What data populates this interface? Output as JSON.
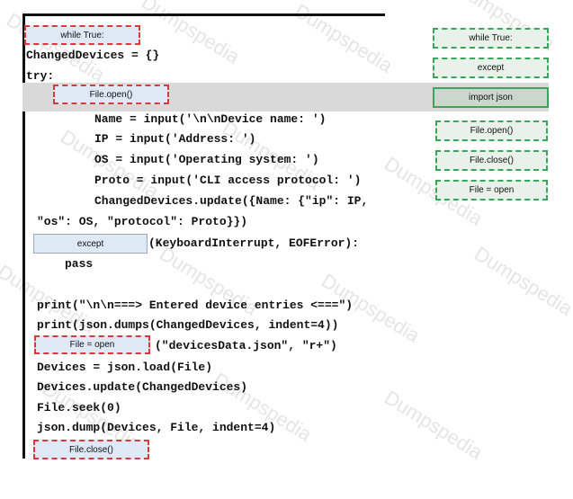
{
  "code": {
    "line_changed_devices": "ChangedDevices = {}",
    "line_try": "try:",
    "line_name": "Name = input('\\n\\nDevice name: ')",
    "line_ip": "IP = input('Address: ')",
    "line_os": "OS = input('Operating system: ')",
    "line_proto": "Proto = input('CLI access protocol: ')",
    "line_update_1": "ChangedDevices.update({Name: {\"ip\": IP,",
    "line_update_2": "\"os\": OS, \"protocol\": Proto}})",
    "line_except_suffix": "(KeyboardInterrupt, EOFError):",
    "line_pass": "pass",
    "line_print1": "print(\"\\n\\n===> Entered device entries <===\")",
    "line_print2": "print(json.dumps(ChangedDevices, indent=4))",
    "line_open_suffix": "(\"devicesData.json\", \"r+\")",
    "line_devices_load": "Devices = json.load(File)",
    "line_devices_update": "Devices.update(ChangedDevices)",
    "line_seek": "File.seek(0)",
    "line_dump": "json.dump(Devices, File, indent=4)"
  },
  "placed": {
    "slot1": "while True:",
    "slot2": "File.open()",
    "slot3": "except",
    "slot4": "File = open",
    "slot5": "File.close()"
  },
  "options": [
    "while True:",
    "except",
    "import json",
    "File.open()",
    "File.close()",
    "File = open"
  ],
  "watermark": "Dumpspedia"
}
